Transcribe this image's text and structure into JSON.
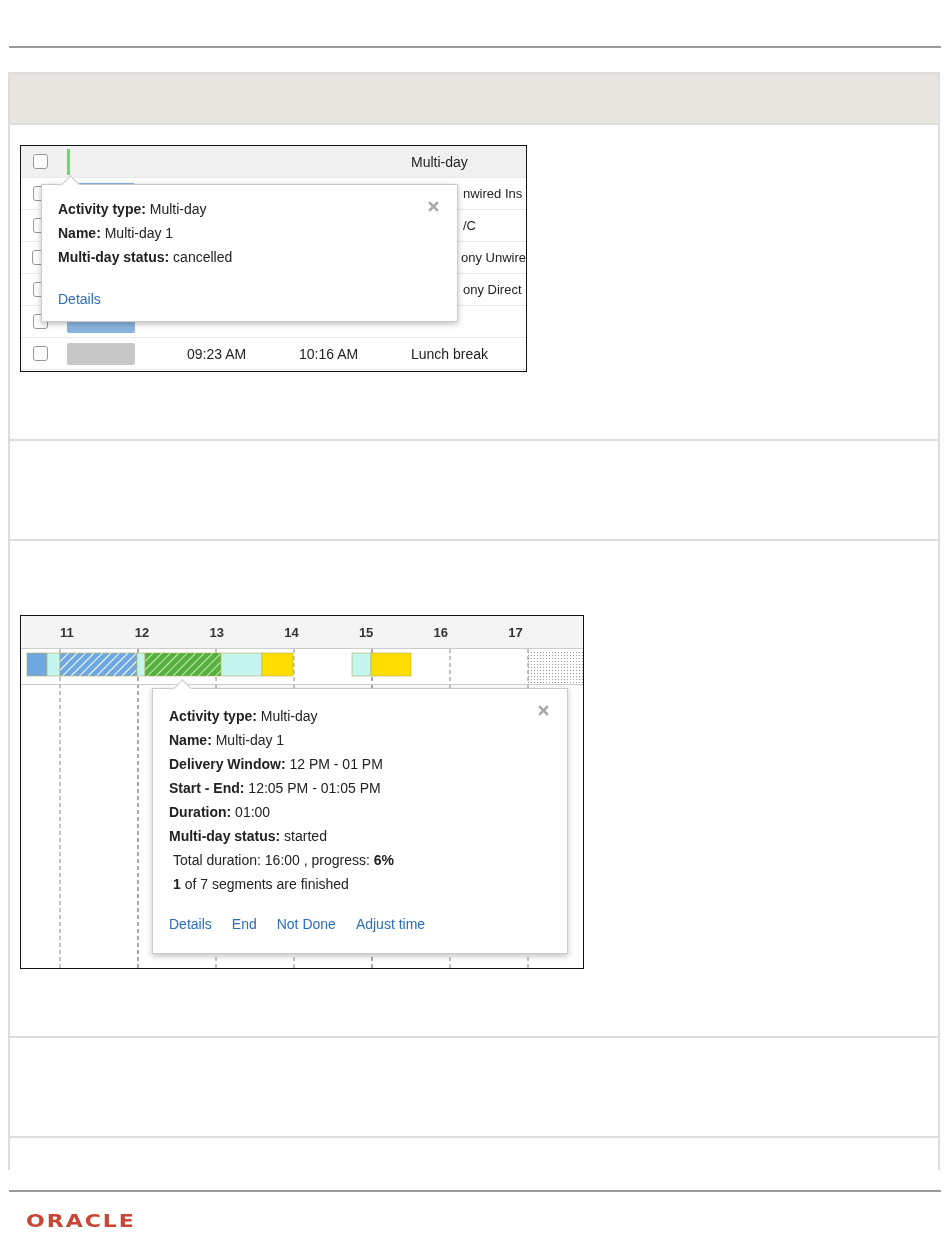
{
  "figure_1": {
    "rows": [
      {
        "kind": "plain",
        "checked": false,
        "selected": true,
        "bar": {
          "kind": "line",
          "color": "#66dd66"
        },
        "name": "Multi-day"
      },
      {
        "kind": "covered",
        "checked": false,
        "selected": false,
        "bar": {
          "kind": "block",
          "color": "#8ab4e0"
        },
        "name": "nwired Ins"
      },
      {
        "kind": "covered",
        "checked": false,
        "selected": false,
        "name": "/C"
      },
      {
        "kind": "covered",
        "checked": false,
        "selected": false,
        "name": "ony Unwire"
      },
      {
        "kind": "covered",
        "checked": false,
        "selected": false,
        "name": "ony Direct"
      },
      {
        "kind": "covered",
        "checked": false,
        "selected": false,
        "bar": {
          "kind": "block",
          "color": "#8ab4e0"
        }
      },
      {
        "kind": "plain",
        "checked": false,
        "selected": false,
        "bar": {
          "kind": "block",
          "color": "#c8c8c8"
        },
        "start": "09:23 AM",
        "end": "10:16 AM",
        "name": "Lunch break"
      }
    ],
    "popup": {
      "lines": [
        {
          "label": "Activity type:",
          "value": "Multi-day"
        },
        {
          "label": "Name:",
          "value": "Multi-day 1"
        },
        {
          "label": "Multi-day status:",
          "value": "cancelled"
        }
      ],
      "links": [
        "Details"
      ]
    }
  },
  "figure_2": {
    "hours": [
      "11",
      "12",
      "13",
      "14",
      "15",
      "16",
      "17"
    ],
    "popup": {
      "lines": [
        {
          "label": "Activity type:",
          "value": "Multi-day"
        },
        {
          "label": "Name:",
          "value": "Multi-day 1"
        },
        {
          "label": "Delivery Window:",
          "value": "12 PM - 01 PM"
        },
        {
          "label": "Start - End:",
          "value": "12:05 PM - 01:05 PM"
        },
        {
          "label": "Duration:",
          "value": "01:00"
        },
        {
          "label": "Multi-day status:",
          "value": "started"
        }
      ],
      "notes": [
        "Total duration: 16:00 , progress: **6%**",
        "**1** of 7 segments are finished"
      ],
      "links": [
        "Details",
        "End",
        "Not Done",
        "Adjust time"
      ]
    }
  },
  "footer": {
    "logo": "ORACLE"
  }
}
